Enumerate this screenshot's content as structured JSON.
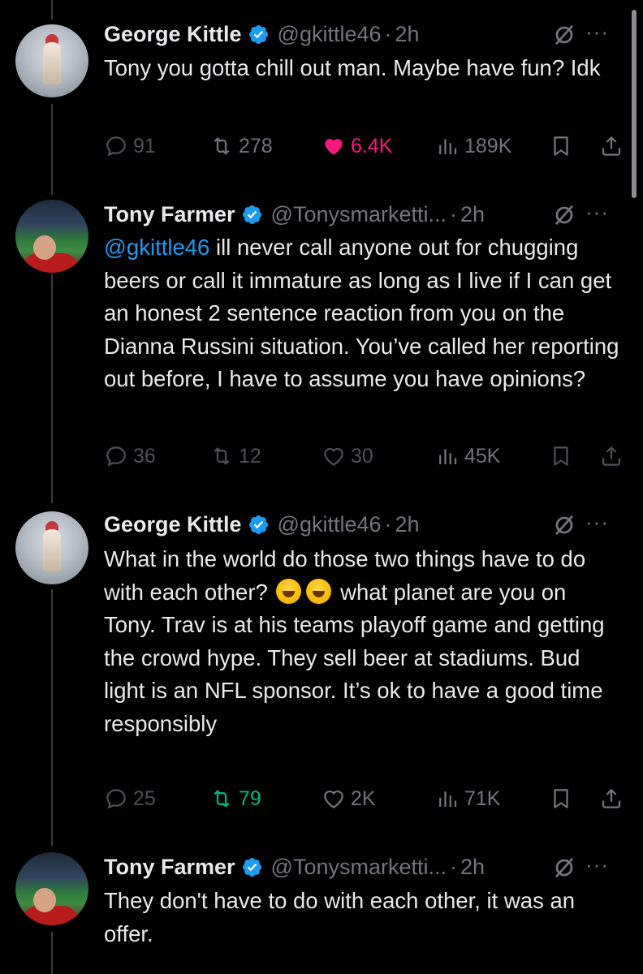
{
  "tweets": [
    {
      "name": "George Kittle",
      "handle": "@gkittle46",
      "time": "2h",
      "text": "Tony you gotta chill out man. Maybe have fun? Idk",
      "replies": "91",
      "retweets": "278",
      "likes": "6.4K",
      "views": "189K",
      "liked": true
    },
    {
      "name": "Tony Farmer",
      "handle": "@Tonysmarketti...",
      "time": "2h",
      "mention": "@gkittle46",
      "text": "ill never call anyone out for chugging beers or call it immature as long as I live if I can get an honest 2 sentence reaction from you on the Dianna Russini situation. You’ve called her reporting out before, I have to assume you have opinions?",
      "replies": "36",
      "retweets": "12",
      "likes": "30",
      "views": "45K"
    },
    {
      "name": "George Kittle",
      "handle": "@gkittle46",
      "time": "2h",
      "text_before_emoji": "What in the world do those two things have to do with each other?",
      "text_after_emoji": "what planet are you on Tony. Trav is at his teams playoff game and getting the crowd hype. They sell beer at stadiums. Bud light is an NFL sponsor. It’s ok to have a good time responsibly",
      "emoji": "rolling-on-floor-laughing",
      "replies": "25",
      "retweets": "79",
      "likes": "2K",
      "views": "71K",
      "retweeted": true
    },
    {
      "name": "Tony Farmer",
      "handle": "@Tonysmarketti...",
      "time": "2h",
      "text": "They don't have to do with each other, it was an offer."
    }
  ],
  "separator": "·",
  "more_label": "···",
  "colors": {
    "background": "#000000",
    "text": "#e7e9ea",
    "secondary": "#71767b",
    "link": "#1d9bf0",
    "like": "#f91880",
    "retweet": "#00ba7c",
    "verified": "#1d9bf0"
  },
  "icons": [
    "verified-badge-icon",
    "grok-icon",
    "more-icon",
    "reply-icon",
    "retweet-icon",
    "heart-icon",
    "views-icon",
    "bookmark-icon",
    "share-icon"
  ]
}
